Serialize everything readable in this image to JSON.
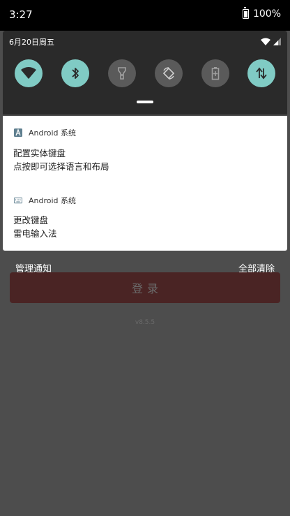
{
  "status_bar": {
    "time": "3:27",
    "battery": "100%"
  },
  "quick_settings": {
    "date": "6月20日周五",
    "tiles": [
      {
        "icon": "wifi-icon",
        "state": "on"
      },
      {
        "icon": "bluetooth-icon",
        "state": "on"
      },
      {
        "icon": "flashlight-icon",
        "state": "off"
      },
      {
        "icon": "auto-rotate-icon",
        "state": "off"
      },
      {
        "icon": "battery-saver-icon",
        "state": "off"
      },
      {
        "icon": "mobile-data-icon",
        "state": "on"
      }
    ]
  },
  "notifications": [
    {
      "app": "Android 系统",
      "icon": "keyboard-settings-icon",
      "title": "配置实体键盘",
      "text": "点按即可选择语言和布局"
    },
    {
      "app": "Android 系统",
      "icon": "keyboard-icon",
      "title": "更改键盘",
      "text": "雷电输入法"
    }
  ],
  "shade_actions": {
    "manage": "管理通知",
    "clear_all": "全部清除"
  },
  "app": {
    "login_label": "登录",
    "version": "v8.5.5"
  },
  "colors": {
    "tile_on": "#80cbc4",
    "tile_off": "#5a5a5a",
    "scrim": "#4d4d4d",
    "login_button": "#4a2424"
  }
}
